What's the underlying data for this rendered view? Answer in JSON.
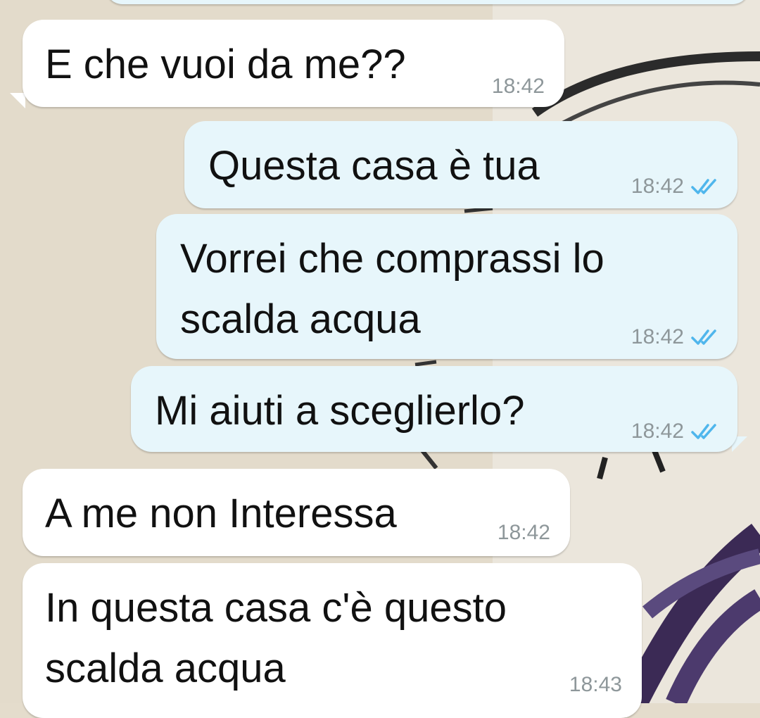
{
  "colors": {
    "incoming_bubble": "#ffffff",
    "outgoing_bubble": "#e7f6fb",
    "read_ticks": "#4fb6ec",
    "timestamp": "#8e979a",
    "wallpaper": "#e4dccc"
  },
  "messages": [
    {
      "direction": "in",
      "lines": [
        "E che vuoi da me??"
      ],
      "time": "18:42"
    },
    {
      "direction": "out",
      "lines": [
        "Questa casa è tua"
      ],
      "time": "18:42",
      "status": "read"
    },
    {
      "direction": "out",
      "lines": [
        "Vorrei che comprassi lo",
        "scalda acqua"
      ],
      "time": "18:42",
      "status": "read"
    },
    {
      "direction": "out",
      "lines": [
        "Mi aiuti a sceglierlo?"
      ],
      "time": "18:42",
      "status": "read"
    },
    {
      "direction": "in",
      "lines": [
        "A me non Interessa"
      ],
      "time": "18:42"
    },
    {
      "direction": "in",
      "lines": [
        "In questa casa c'è questo",
        "scalda acqua"
      ],
      "time": "18:43"
    }
  ],
  "icons": {
    "read_receipt": "double-check-icon"
  }
}
